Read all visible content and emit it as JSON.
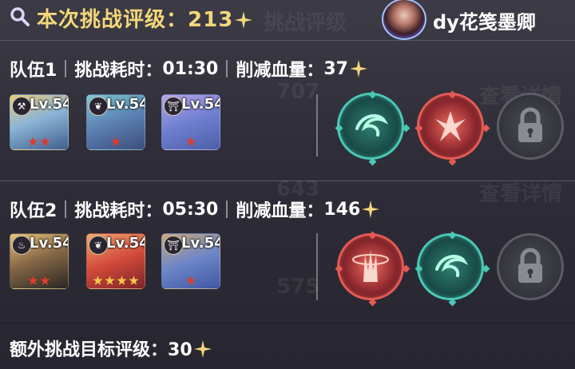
{
  "header": {
    "title_prefix": "本次挑战评级：",
    "title_value": "213",
    "username": "dy花笺墨卿",
    "colors": {
      "gold": "#f3d77a"
    }
  },
  "teams": [
    {
      "name": "队伍1",
      "time_label": "挑战耗时：",
      "time_value": "01:30",
      "damage_label": "削减血量：",
      "damage_value": "37",
      "heroes": [
        {
          "level": "Lv.54",
          "stars": 2,
          "star_color": "red",
          "badge_icon": "axe-icon"
        },
        {
          "level": "Lv.54",
          "stars": 1,
          "star_color": "red",
          "badge_icon": "sprout-icon"
        },
        {
          "level": "Lv.54",
          "stars": 1,
          "star_color": "red",
          "badge_icon": "shrine-icon"
        }
      ],
      "skills": [
        {
          "type": "teal",
          "icon": "wind-swirl-icon"
        },
        {
          "type": "red",
          "icon": "phoenix-icon"
        },
        {
          "type": "locked",
          "icon": "lock-icon"
        }
      ]
    },
    {
      "name": "队伍2",
      "time_label": "挑战耗时：",
      "time_value": "05:30",
      "damage_label": "削减血量：",
      "damage_value": "146",
      "heroes": [
        {
          "level": "Lv.54",
          "stars": 2,
          "star_color": "red",
          "badge_icon": "flame-icon"
        },
        {
          "level": "Lv.54",
          "stars": 5,
          "star_color": "gold",
          "badge_icon": "sprout-icon"
        },
        {
          "level": "Lv.54",
          "stars": 1,
          "star_color": "red",
          "badge_icon": "shrine-icon"
        }
      ],
      "skills": [
        {
          "type": "red",
          "icon": "flame-pillar-icon"
        },
        {
          "type": "teal",
          "icon": "wind-swirl-icon"
        },
        {
          "type": "locked",
          "icon": "lock-icon"
        }
      ]
    }
  ],
  "footer": {
    "label": "额外挑战目标评级：",
    "value": "30"
  }
}
